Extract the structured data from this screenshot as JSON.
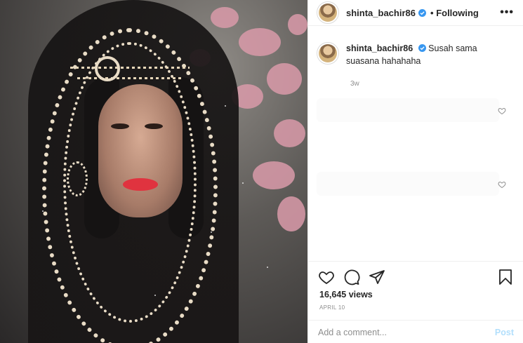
{
  "post": {
    "username": "shinta_bachir86",
    "follow_status": "Following",
    "separator": "•",
    "more_label": "•••"
  },
  "caption": {
    "username": "shinta_bachir86",
    "text": "Susah sama suasana hahahaha",
    "age": "3w"
  },
  "stats": {
    "views": "16,645 views",
    "date": "APRIL 10"
  },
  "comment": {
    "placeholder": "Add a comment...",
    "post_label": "Post"
  },
  "colors": {
    "verified": "#3897f0",
    "post_disabled": "#b2dffc",
    "lips": "#e0333f"
  },
  "icons": [
    "verified-icon",
    "more-icon",
    "heart-icon",
    "comment-icon",
    "share-icon",
    "bookmark-icon"
  ]
}
